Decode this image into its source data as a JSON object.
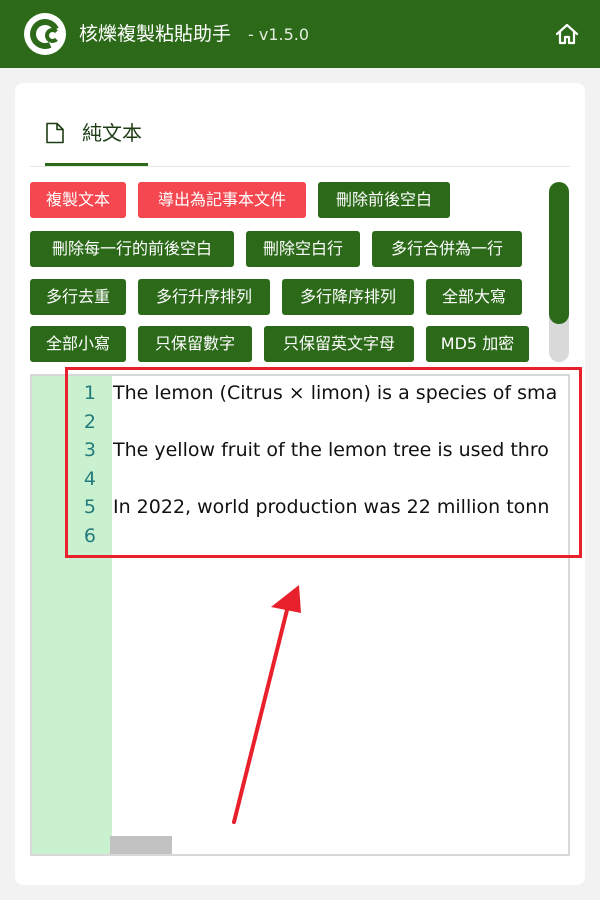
{
  "header": {
    "title": "核爍複製粘貼助手",
    "version": "- v1.5.0",
    "icons": {
      "logo": "app-logo-c",
      "home": "home-icon"
    },
    "colors": {
      "brand": "#2c6a1a"
    }
  },
  "tabs": [
    {
      "label": "純文本",
      "icon": "document-icon",
      "active": true
    }
  ],
  "toolbar": {
    "buttons": [
      {
        "label": "複製文本",
        "style": "red"
      },
      {
        "label": "導出為記事本文件",
        "style": "red"
      },
      {
        "label": "刪除前後空白",
        "style": "green"
      },
      {
        "label": "刪除每一行的前後空白",
        "style": "green"
      },
      {
        "label": "刪除空白行",
        "style": "green"
      },
      {
        "label": "多行合併為一行",
        "style": "green"
      },
      {
        "label": "多行去重",
        "style": "green"
      },
      {
        "label": "多行升序排列",
        "style": "green"
      },
      {
        "label": "多行降序排列",
        "style": "green"
      },
      {
        "label": "全部大寫",
        "style": "green"
      },
      {
        "label": "全部小寫",
        "style": "green"
      },
      {
        "label": "只保留數字",
        "style": "green"
      },
      {
        "label": "只保留英文字母",
        "style": "green"
      },
      {
        "label": "MD5 加密",
        "style": "green"
      }
    ],
    "colors": {
      "red": "#f4474f",
      "green": "#2c6a1a"
    }
  },
  "editor": {
    "lines": [
      {
        "num": "1",
        "text": "The lemon (Citrus × limon) is a species of sma"
      },
      {
        "num": "2",
        "text": ""
      },
      {
        "num": "3",
        "text": "The yellow fruit of the lemon tree is used thro"
      },
      {
        "num": "4",
        "text": ""
      },
      {
        "num": "5",
        "text": "In 2022, world production was 22 million tonn"
      },
      {
        "num": "6",
        "text": ""
      }
    ],
    "colors": {
      "gutter": "#c9f0cf",
      "line_number": "#237b7b"
    }
  },
  "annotation": {
    "colors": {
      "highlight": "#e8202c"
    }
  }
}
